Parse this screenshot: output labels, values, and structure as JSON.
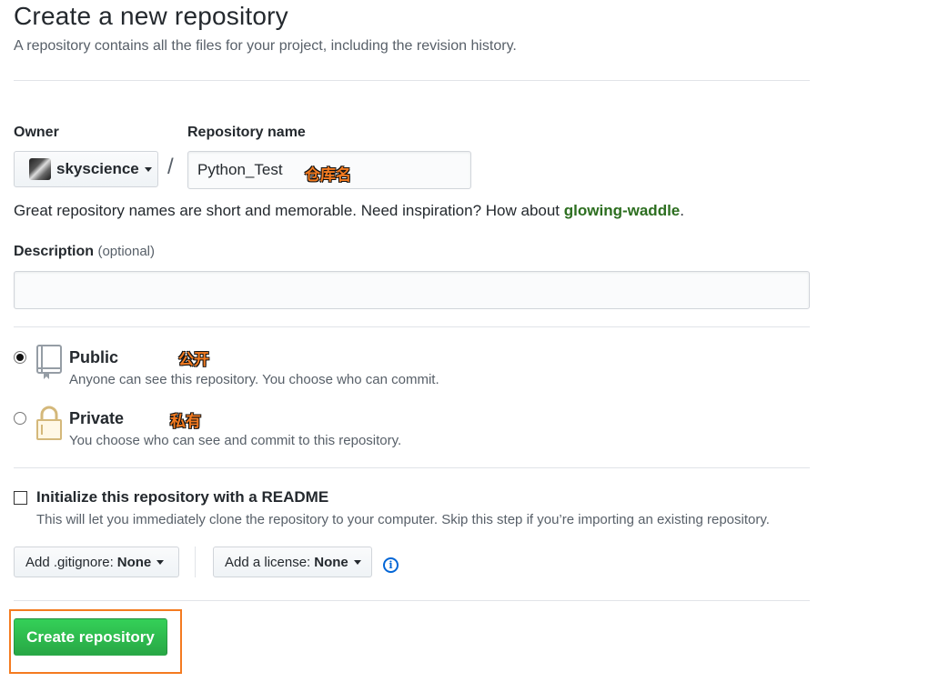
{
  "header": {
    "title": "Create a new repository",
    "subtitle": "A repository contains all the files for your project, including the revision history."
  },
  "owner": {
    "label": "Owner",
    "name": "skyscience"
  },
  "repo": {
    "label": "Repository name",
    "value": "Python_Test",
    "annotation": "仓库名",
    "slash": "/"
  },
  "hint": {
    "text": "Great repository names are short and memorable. Need inspiration? How about ",
    "suggestion": "glowing-waddle",
    "end": "."
  },
  "description": {
    "label": "Description",
    "optional": "(optional)",
    "value": ""
  },
  "visibility": {
    "public": {
      "title": "Public",
      "note": "Anyone can see this repository. You choose who can commit.",
      "annotation": "公开",
      "selected": true
    },
    "private": {
      "title": "Private",
      "note": "You choose who can see and commit to this repository.",
      "annotation": "私有",
      "selected": false
    }
  },
  "readme": {
    "label": "Initialize this repository with a README",
    "note": "This will let you immediately clone the repository to your computer. Skip this step if you’re importing an existing repository.",
    "checked": false
  },
  "gitignore": {
    "label": "Add .gitignore:",
    "value": "None"
  },
  "license": {
    "label": "Add a license:",
    "value": "None"
  },
  "info_icon": "i",
  "create_button": "Create repository",
  "colors": {
    "accent_green": "#28a745",
    "annotation_orange": "#f47b20",
    "link_blue": "#0366d6"
  }
}
